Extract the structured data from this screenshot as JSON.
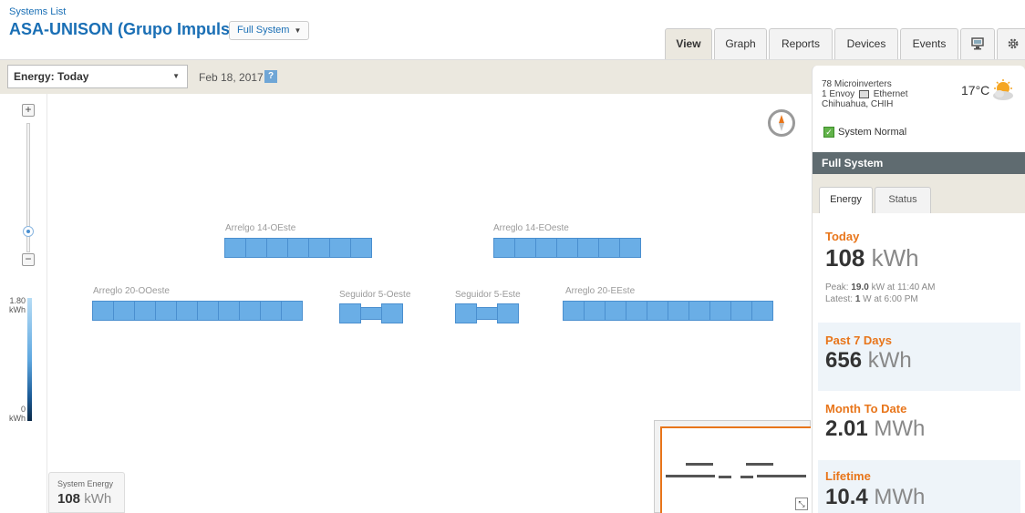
{
  "header": {
    "systems_list": "Systems List",
    "site_title": "ASA-UNISON (Grupo Impulsor)",
    "system_dropdown": "Full System"
  },
  "tabs": [
    {
      "label": "View",
      "active": true
    },
    {
      "label": "Graph"
    },
    {
      "label": "Reports"
    },
    {
      "label": "Devices"
    },
    {
      "label": "Events"
    },
    {
      "icon": "monitor-icon"
    },
    {
      "icon": "gear-icon"
    }
  ],
  "toolbar": {
    "energy_select": "Energy: Today",
    "date": "Feb 18, 2017",
    "help": "?"
  },
  "map": {
    "zoom_in": "+",
    "zoom_out": "−",
    "scale_max_value": "1.80",
    "scale_max_unit": "kWh",
    "scale_min_value": "0",
    "scale_min_unit": "kWh",
    "arrays": [
      {
        "label": "Arrelgo 14-OEste",
        "panels": 7
      },
      {
        "label": "Arreglo 14-EOeste",
        "panels": 7
      },
      {
        "label": "Arreglo 20-OOeste",
        "panels": 10
      },
      {
        "label": "Seguidor 5-Oeste",
        "panels": 3
      },
      {
        "label": "Seguidor 5-Este",
        "panels": 3
      },
      {
        "label": "Arreglo 20-EEste",
        "panels": 10
      }
    ],
    "system_energy_label": "System Energy",
    "system_energy_value": "108",
    "system_energy_unit": "kWh"
  },
  "info": {
    "microinverters": "78 Microinverters",
    "envoy_count": "1 Envoy",
    "envoy_conn": "Ethernet",
    "location": "Chihuahua, CHIH",
    "temperature": "17°C",
    "weather_icon": "partly-sunny-icon",
    "status": "System Normal"
  },
  "panel": {
    "title": "Full System",
    "tab_energy": "Energy",
    "tab_status": "Status"
  },
  "stats": {
    "today_label": "Today",
    "today_value": "108",
    "today_unit": "kWh",
    "peak_prefix": "Peak:",
    "peak_value": "19.0",
    "peak_suffix": "kW at 11:40 AM",
    "latest_prefix": "Latest:",
    "latest_value": "1",
    "latest_suffix": "W at 6:00 PM",
    "week_label": "Past 7 Days",
    "week_value": "656",
    "week_unit": "kWh",
    "month_label": "Month To Date",
    "month_value": "2.01",
    "month_unit": "MWh",
    "life_label": "Lifetime",
    "life_value": "10.4",
    "life_unit": "MWh"
  }
}
